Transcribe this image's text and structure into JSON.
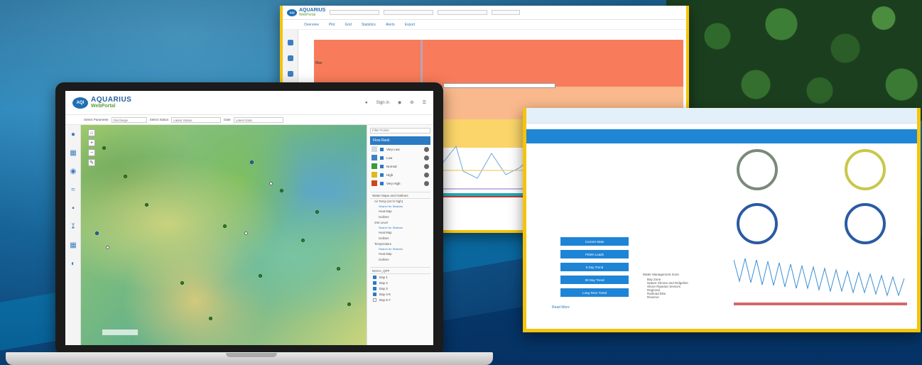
{
  "colors": {
    "accent": "#2b7ac4",
    "frame_yellow": "#f5c40a",
    "very_high": "#f87b5b",
    "high": "#f9b98c",
    "normal": "#fbd56a",
    "low": "#3f7fc6",
    "very_low": "#cfd9e6"
  },
  "laptop": {
    "logo_badge": "AQI",
    "brand": "AQUARIUS",
    "product": "WebPortal",
    "header": {
      "sign_in": "Sign in"
    },
    "filters": {
      "parameter_label": "Select Parameter",
      "parameter_value": "Discharge",
      "status_label": "Select Status",
      "status_value": "Latest Status",
      "date_label": "Date",
      "date_value": "Latest Data"
    },
    "legend": {
      "search": "Filter Points",
      "header": "Flow Rank",
      "items": [
        {
          "label": "Very Low"
        },
        {
          "label": "Low"
        },
        {
          "label": "Normal"
        },
        {
          "label": "High"
        },
        {
          "label": "Very High"
        }
      ]
    },
    "sections": {
      "layers_title": "Water Maps and Outlines",
      "layers": [
        {
          "name": "Air Temp (24 hr high)",
          "sub": "Search for Stations",
          "opts": [
            "Heat Map",
            "Isolines"
          ]
        },
        {
          "name": "GW Level",
          "sub": "Search for Stations",
          "opts": [
            "Heat Map",
            "Isolines"
          ]
        },
        {
          "name": "Temperature",
          "sub": "Search for Stations",
          "opts": [
            "Heat Map",
            "Isolines"
          ]
        }
      ],
      "forecast_title": "NOAA_QPF",
      "days": [
        "Day 1",
        "Day 2",
        "Day 3",
        "Day 4-5",
        "Day 6-7"
      ]
    }
  },
  "top_window": {
    "brand": "AQUARIUS",
    "product": "WebPortal",
    "tabs": [
      "Overview",
      "Plot",
      "Grid",
      "Statistics",
      "Alerts",
      "Export"
    ],
    "band_label": "Max"
  },
  "right_window": {
    "buttons": [
      "Current Stats",
      "FEMA Loads",
      "5 Day Trend",
      "30 Day Trend",
      "Long Term Trend"
    ],
    "legend_title": "Water Management Zone",
    "legend_items": [
      "Bay Zone",
      "Nature Shores and Ridgeline",
      "Shore Riparian Sevices",
      "Regional",
      "Railroad bike",
      "Reserve"
    ],
    "read_more": "Read More"
  }
}
